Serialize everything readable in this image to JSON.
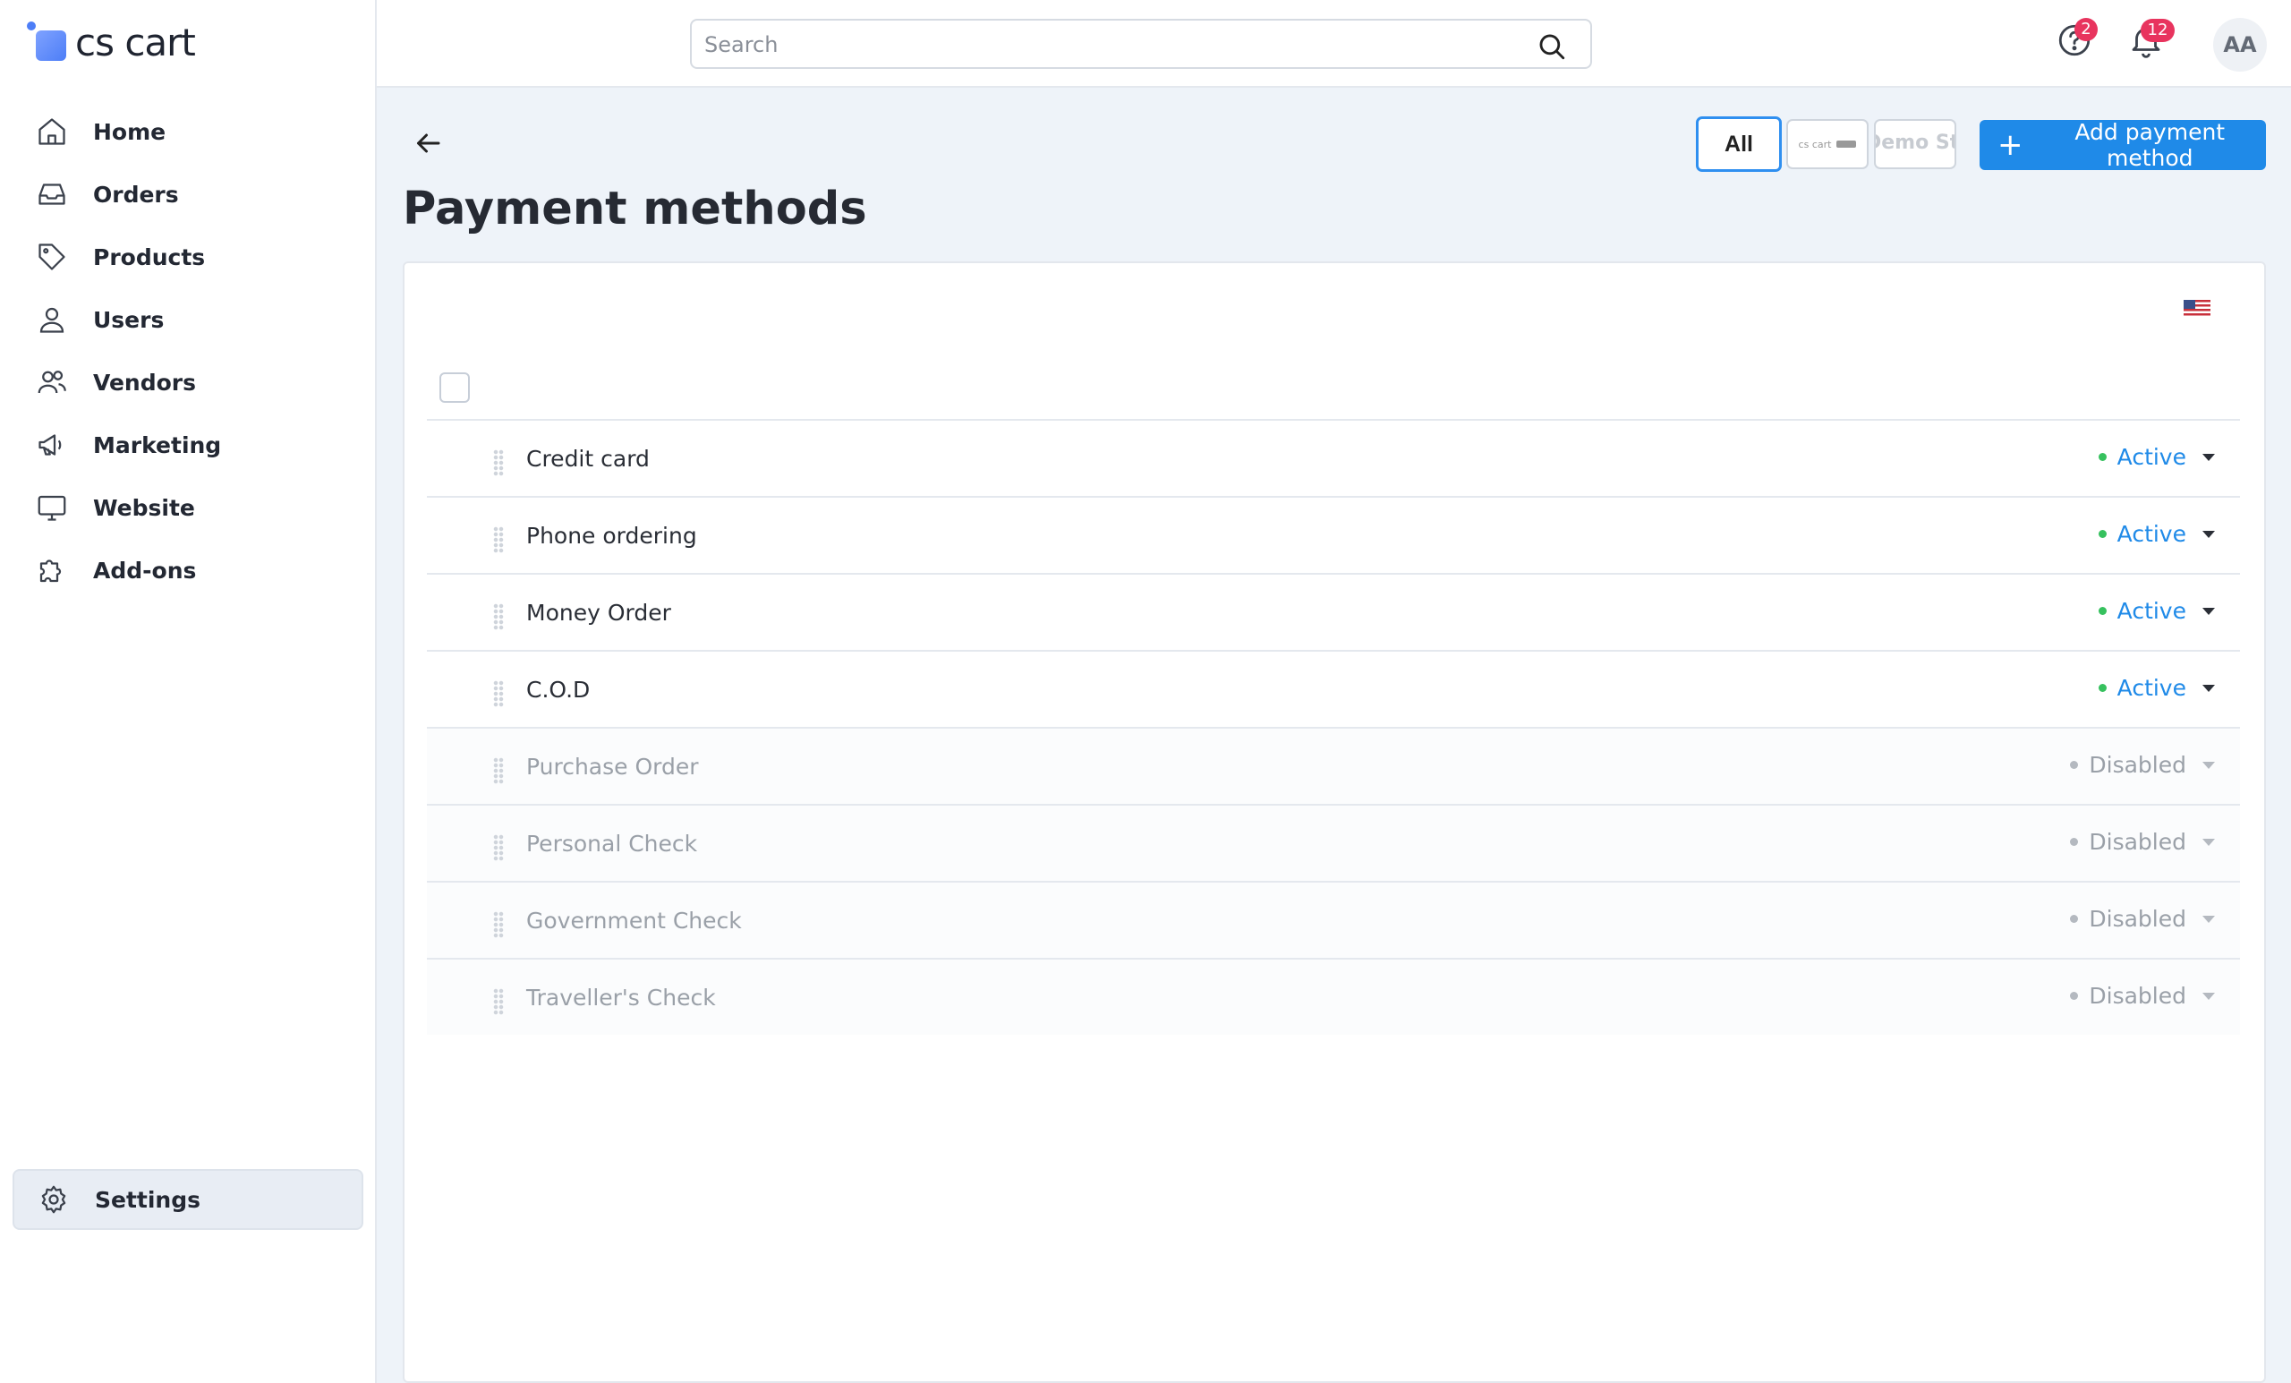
{
  "app": {
    "logo_text": "cs cart"
  },
  "sidebar": {
    "items": [
      {
        "id": "home",
        "label": "Home",
        "icon": "home-icon"
      },
      {
        "id": "orders",
        "label": "Orders",
        "icon": "inbox-icon"
      },
      {
        "id": "products",
        "label": "Products",
        "icon": "tag-icon"
      },
      {
        "id": "users",
        "label": "Users",
        "icon": "user-icon"
      },
      {
        "id": "vendors",
        "label": "Vendors",
        "icon": "users-icon"
      },
      {
        "id": "marketing",
        "label": "Marketing",
        "icon": "megaphone-icon"
      },
      {
        "id": "website",
        "label": "Website",
        "icon": "monitor-icon"
      },
      {
        "id": "addons",
        "label": "Add-ons",
        "icon": "puzzle-icon"
      }
    ],
    "settings_label": "Settings"
  },
  "header": {
    "search_placeholder": "Search",
    "help_badge": "2",
    "notifications_badge": "12",
    "avatar_initials": "AA"
  },
  "toolbar": {
    "store_all_label": "All",
    "store_cs_label": "cs cart",
    "store_demo_label": "Demo Store",
    "add_button_label": "Add payment method"
  },
  "page": {
    "title": "Payment methods"
  },
  "payment_methods": [
    {
      "name": "Credit card",
      "status": "Active",
      "state": "active"
    },
    {
      "name": "Phone ordering",
      "status": "Active",
      "state": "active"
    },
    {
      "name": "Money Order",
      "status": "Active",
      "state": "active"
    },
    {
      "name": "C.O.D",
      "status": "Active",
      "state": "active"
    },
    {
      "name": "Purchase Order",
      "status": "Disabled",
      "state": "disabled"
    },
    {
      "name": "Personal Check",
      "status": "Disabled",
      "state": "disabled"
    },
    {
      "name": "Government Check",
      "status": "Disabled",
      "state": "disabled"
    },
    {
      "name": "Traveller's Check",
      "status": "Disabled",
      "state": "disabled"
    }
  ],
  "colors": {
    "accent": "#1f8ae8",
    "active_dot": "#36c15e",
    "badge": "#e8345e",
    "disabled_text": "#9aa0a8"
  }
}
